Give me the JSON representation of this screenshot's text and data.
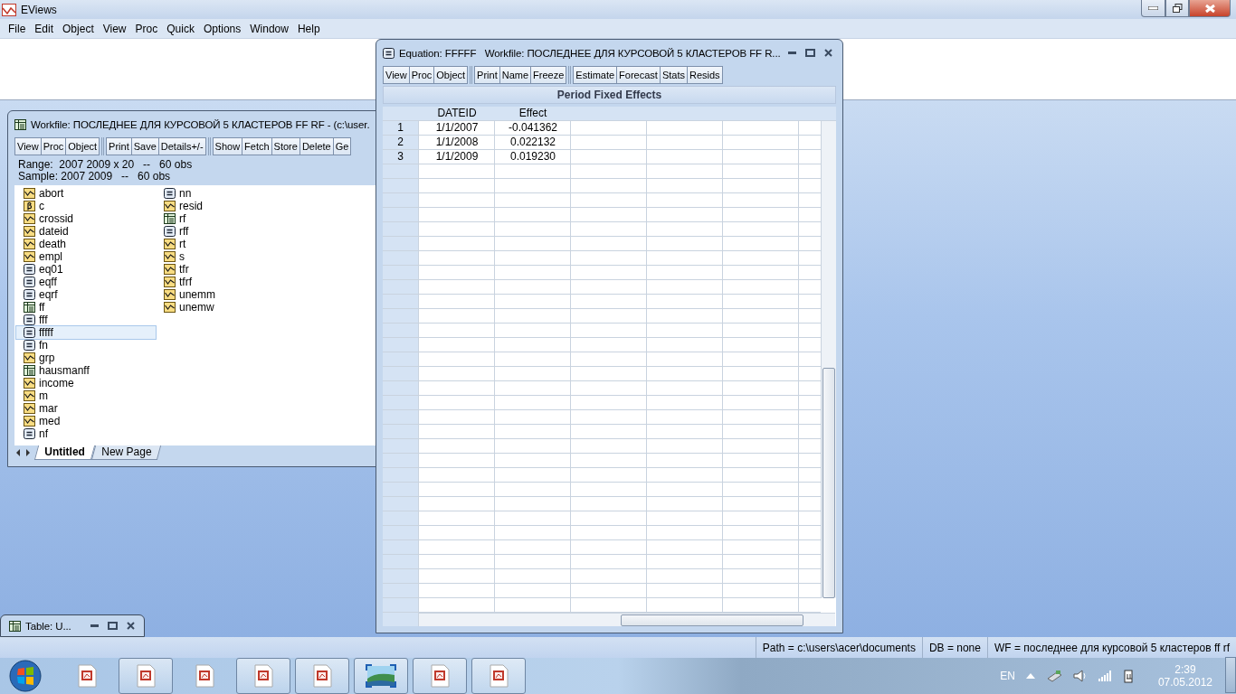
{
  "app": {
    "title": "EViews"
  },
  "menu": [
    "File",
    "Edit",
    "Object",
    "View",
    "Proc",
    "Quick",
    "Options",
    "Window",
    "Help"
  ],
  "workfile": {
    "title": "Workfile: ПОСЛЕДНЕЕ ДЛЯ КУРСОВОЙ 5 КЛАСТЕРОВ FF RF - (c:\\user.",
    "toolbar_groups": [
      [
        "View",
        "Proc",
        "Object"
      ],
      [
        "Print",
        "Save",
        "Details+/-"
      ],
      [
        "Show",
        "Fetch",
        "Store",
        "Delete",
        "Ge"
      ]
    ],
    "range": "Range:  2007 2009 x 20   --   60 obs",
    "sample": "Sample: 2007 2009   --   60 obs",
    "objects": [
      {
        "name": "abort",
        "kind": "series",
        "selected": false
      },
      {
        "name": "c",
        "kind": "coefficient",
        "selected": false
      },
      {
        "name": "crossid",
        "kind": "series",
        "selected": false
      },
      {
        "name": "dateid",
        "kind": "series",
        "selected": false
      },
      {
        "name": "death",
        "kind": "series",
        "selected": false
      },
      {
        "name": "empl",
        "kind": "series",
        "selected": false
      },
      {
        "name": "eq01",
        "kind": "equation",
        "selected": false
      },
      {
        "name": "eqff",
        "kind": "equation",
        "selected": false
      },
      {
        "name": "eqrf",
        "kind": "equation",
        "selected": false
      },
      {
        "name": "ff",
        "kind": "table",
        "selected": false
      },
      {
        "name": "fff",
        "kind": "equation",
        "selected": false
      },
      {
        "name": "fffff",
        "kind": "equation",
        "selected": true
      },
      {
        "name": "fn",
        "kind": "equation",
        "selected": false
      },
      {
        "name": "grp",
        "kind": "series",
        "selected": false
      },
      {
        "name": "hausmanff",
        "kind": "table",
        "selected": false
      },
      {
        "name": "income",
        "kind": "series",
        "selected": false
      },
      {
        "name": "m",
        "kind": "series",
        "selected": false
      },
      {
        "name": "mar",
        "kind": "series",
        "selected": false
      },
      {
        "name": "med",
        "kind": "series",
        "selected": false
      },
      {
        "name": "nf",
        "kind": "equation",
        "selected": false
      },
      {
        "name": "nn",
        "kind": "equation",
        "selected": false
      },
      {
        "name": "resid",
        "kind": "series",
        "selected": false
      },
      {
        "name": "rf",
        "kind": "table",
        "selected": false
      },
      {
        "name": "rff",
        "kind": "equation",
        "selected": false
      },
      {
        "name": "rt",
        "kind": "series",
        "selected": false
      },
      {
        "name": "s",
        "kind": "series",
        "selected": false
      },
      {
        "name": "tfr",
        "kind": "series",
        "selected": false
      },
      {
        "name": "tfrf",
        "kind": "series",
        "selected": false
      },
      {
        "name": "unemm",
        "kind": "series",
        "selected": false
      },
      {
        "name": "unemw",
        "kind": "series",
        "selected": false
      }
    ],
    "page_tabs": [
      {
        "label": "Untitled",
        "selected": true
      },
      {
        "label": "New Page",
        "selected": false
      }
    ]
  },
  "equation": {
    "title": "Equation: FFFFF   Workfile: ПОСЛЕДНЕЕ ДЛЯ КУРСОВОЙ 5 КЛАСТЕРОВ FF R...",
    "toolbar_groups": [
      [
        "View",
        "Proc",
        "Object"
      ],
      [
        "Print",
        "Name",
        "Freeze"
      ],
      [
        "Estimate",
        "Forecast",
        "Stats",
        "Resids"
      ]
    ],
    "table_title": "Period Fixed Effects",
    "columns": [
      "DATEID",
      "Effect"
    ],
    "rows": [
      {
        "number": "1",
        "cells": [
          "1/1/2007",
          "-0.041362"
        ]
      },
      {
        "number": "2",
        "cells": [
          "1/1/2008",
          "0.022132"
        ]
      },
      {
        "number": "3",
        "cells": [
          "1/1/2009",
          "0.019230"
        ]
      }
    ]
  },
  "minimized_window": {
    "title": "Table: U..."
  },
  "status_bar": [
    "Path = c:\\users\\acer\\documents",
    "DB = none",
    "WF = последнее для курсовой 5 кластеров ff rf"
  ],
  "taskbar": {
    "buttons": [
      {
        "kind": "document",
        "framed": false
      },
      {
        "kind": "document",
        "framed": true
      },
      {
        "kind": "document",
        "framed": false
      },
      {
        "kind": "document",
        "framed": true
      },
      {
        "kind": "document",
        "framed": true
      },
      {
        "kind": "picture",
        "framed": true
      },
      {
        "kind": "document",
        "framed": true
      },
      {
        "kind": "document",
        "framed": true
      }
    ],
    "language": "EN",
    "time": "2:39",
    "date": "07.05.2012"
  }
}
